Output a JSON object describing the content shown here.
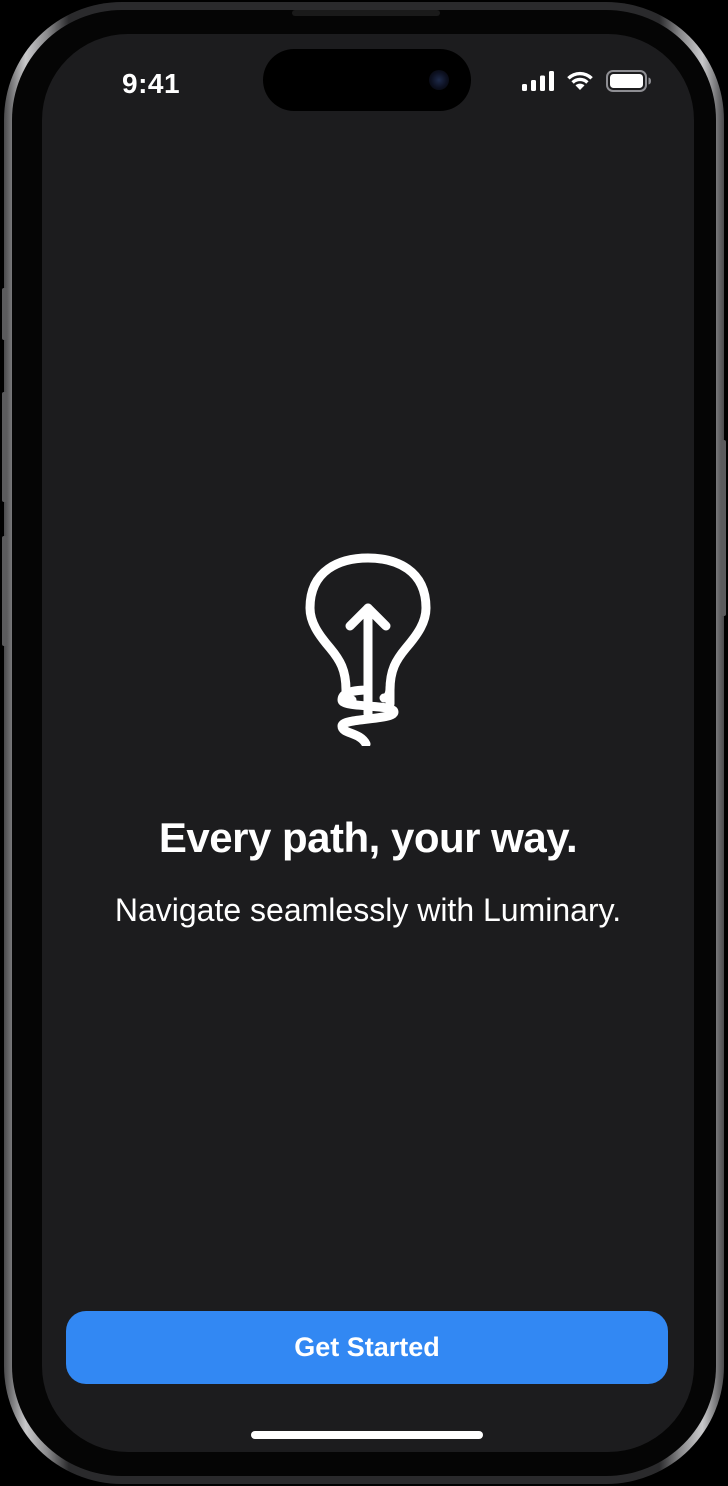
{
  "status_bar": {
    "time": "9:41",
    "icons": [
      "cellular-signal-icon",
      "wifi-icon",
      "battery-icon"
    ]
  },
  "onboarding": {
    "illustration_icon": "lightbulb-arrow-icon",
    "headline": "Every path, your way.",
    "subheadline": "Navigate seamlessly with Luminary.",
    "cta_label": "Get Started"
  },
  "colors": {
    "background": "#1c1c1e",
    "accent": "#3288f3",
    "text": "#ffffff"
  }
}
